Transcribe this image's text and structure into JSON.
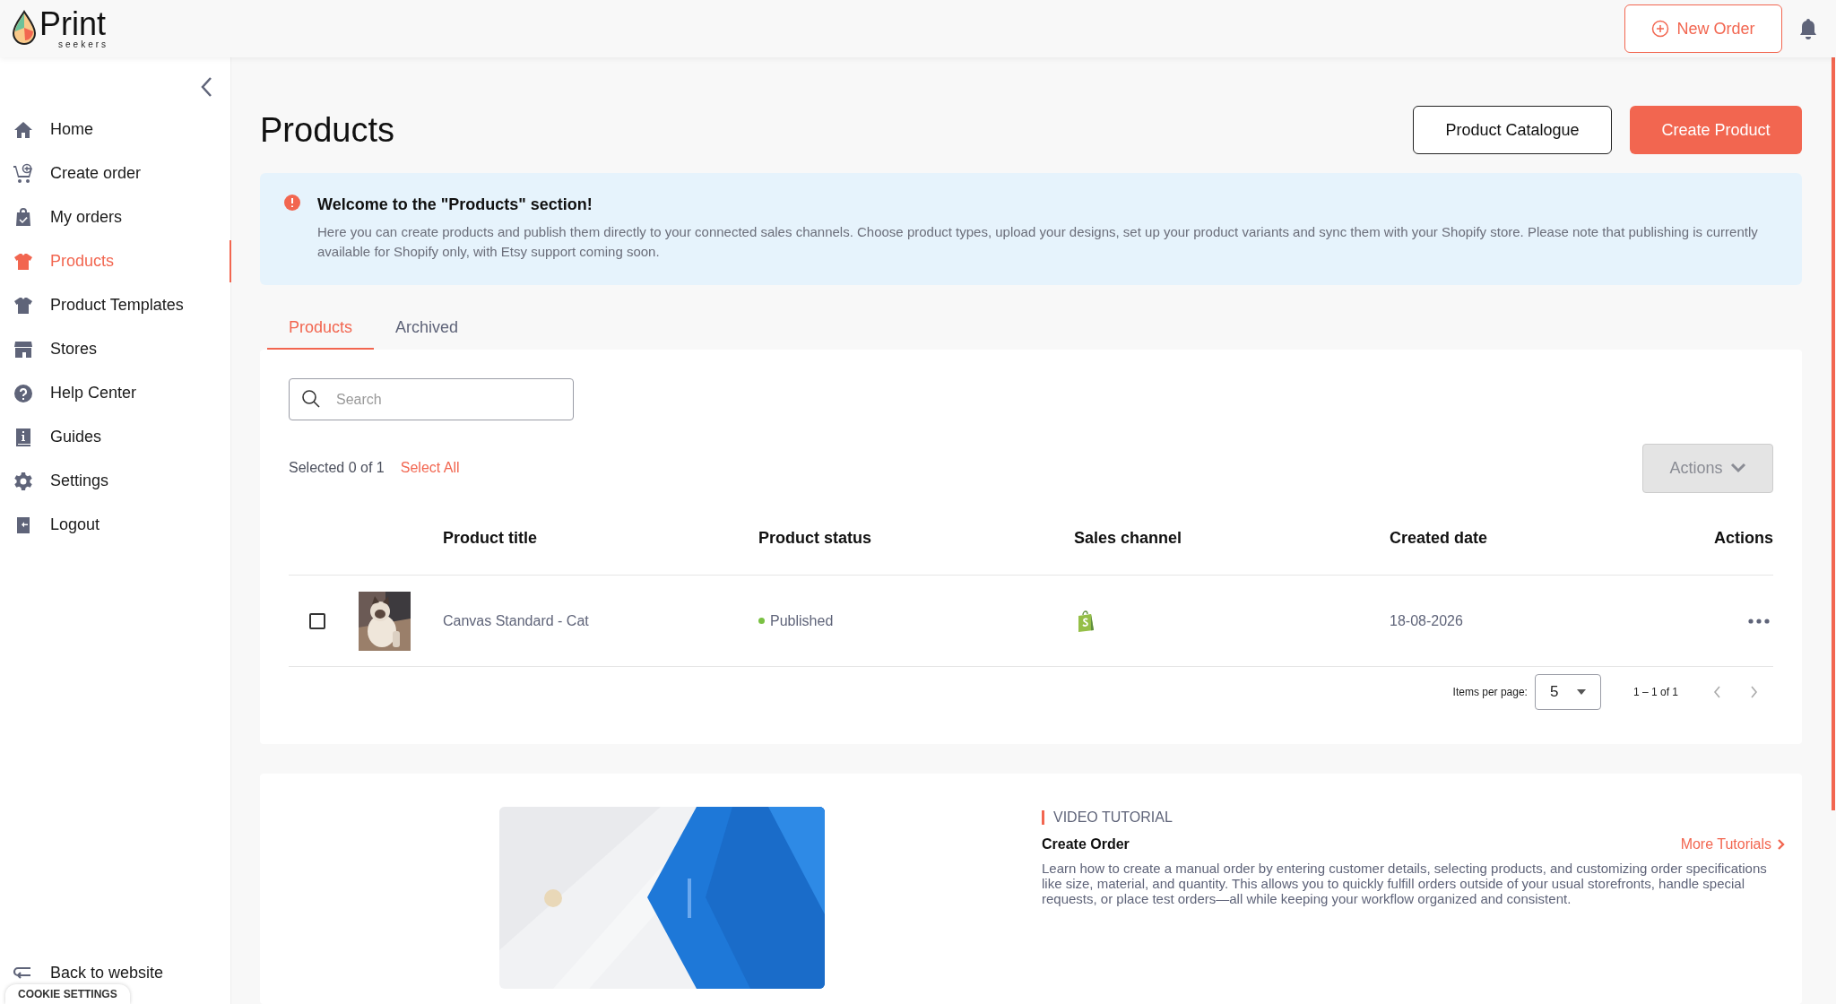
{
  "header": {
    "logo": {
      "name": "Print",
      "tagline": "seekers"
    },
    "new_order_button": "New Order"
  },
  "sidebar": {
    "items": [
      {
        "label": "Home",
        "kind": "home",
        "selected": false
      },
      {
        "label": "Create order",
        "kind": "cart",
        "selected": false
      },
      {
        "label": "My orders",
        "kind": "bag",
        "selected": false
      },
      {
        "label": "Products",
        "kind": "shirt",
        "selected": true
      },
      {
        "label": "Product Templates",
        "kind": "shirt",
        "selected": false
      },
      {
        "label": "Stores",
        "kind": "store",
        "selected": false
      },
      {
        "label": "Help Center",
        "kind": "help",
        "selected": false
      },
      {
        "label": "Guides",
        "kind": "book",
        "selected": false
      },
      {
        "label": "Settings",
        "kind": "gear",
        "selected": false
      },
      {
        "label": "Logout",
        "kind": "logout",
        "selected": false
      }
    ],
    "back_link": "Back to website"
  },
  "cookie_button": "COOKIE SETTINGS",
  "page": {
    "title": "Products",
    "buttons": [
      "Product Catalogue",
      "Create Product"
    ]
  },
  "notice": {
    "title": "Welcome to the \"Products\" section!",
    "text": "Here you can create products and publish them directly to your connected sales channels. Choose product types, upload your designs, set up your product variants and sync them with your Shopify store. Please note that publishing is currently available for Shopify only, with Etsy support coming soon."
  },
  "tabs": [
    {
      "label": "Products",
      "selected": true
    },
    {
      "label": "Archived",
      "selected": false
    }
  ],
  "search": {
    "placeholder": "Search"
  },
  "selection": {
    "text": "Selected 0 of 1",
    "select_all": "Select All"
  },
  "actions_button": {
    "label": "Actions",
    "disabled": true
  },
  "table": {
    "columns": [
      "Product title",
      "Product status",
      "Sales channel",
      "Created date",
      "Actions"
    ],
    "rows": [
      {
        "checked": false,
        "title": "Canvas Standard - Cat",
        "status": "Published",
        "date": "18-08-2026"
      }
    ]
  },
  "pagination": {
    "label": "Items per page:",
    "per_page": "5",
    "range": "1 – 1 of 1"
  },
  "tutorial": {
    "eyebrow": "VIDEO TUTORIAL",
    "title": "Create Order",
    "more": "More Tutorials",
    "text": "Learn how to create a manual order by entering customer details, selecting products, and customizing order specifications like size, material, and quantity. This allows you to quickly fulfill orders outside of your usual storefronts, handle special requests, or place test orders—all while keeping your workflow organized and consistent."
  }
}
